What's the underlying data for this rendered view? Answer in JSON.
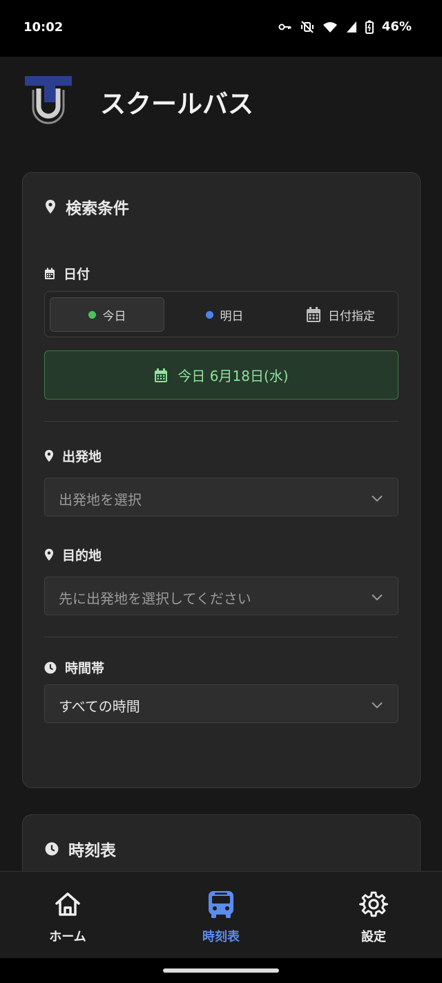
{
  "status_bar": {
    "time": "10:02",
    "battery": "46%",
    "icons": [
      "key-icon",
      "mute-vibrate-icon",
      "wifi-icon",
      "signal-icon",
      "battery-icon"
    ]
  },
  "header": {
    "title": "スクールバス",
    "logo": "tu-logo"
  },
  "search_card": {
    "title": "検索条件",
    "date_section": {
      "label": "日付",
      "options": [
        {
          "label": "今日",
          "dot_color": "#4cc35e",
          "selected": true
        },
        {
          "label": "明日",
          "dot_color": "#4f82ea",
          "selected": false
        },
        {
          "label": "日付指定",
          "icon": "calendar-icon",
          "selected": false
        }
      ],
      "selected_banner": "今日 6月18日(水)"
    },
    "departure": {
      "label": "出発地",
      "placeholder": "出発地を選択"
    },
    "destination": {
      "label": "目的地",
      "placeholder": "先に出発地を選択してください"
    },
    "time_band": {
      "label": "時間帯",
      "value": "すべての時間"
    }
  },
  "timetable_card": {
    "title": "時刻表"
  },
  "bottom_nav": {
    "items": [
      {
        "label": "ホーム",
        "icon": "home-icon",
        "active": false
      },
      {
        "label": "時刻表",
        "icon": "bus-icon",
        "active": true
      },
      {
        "label": "設定",
        "icon": "gear-icon",
        "active": false
      }
    ]
  },
  "colors": {
    "accent_blue": "#5b8cf0",
    "success_green": "#8fe39d",
    "background": "#181818",
    "card": "#262626"
  }
}
